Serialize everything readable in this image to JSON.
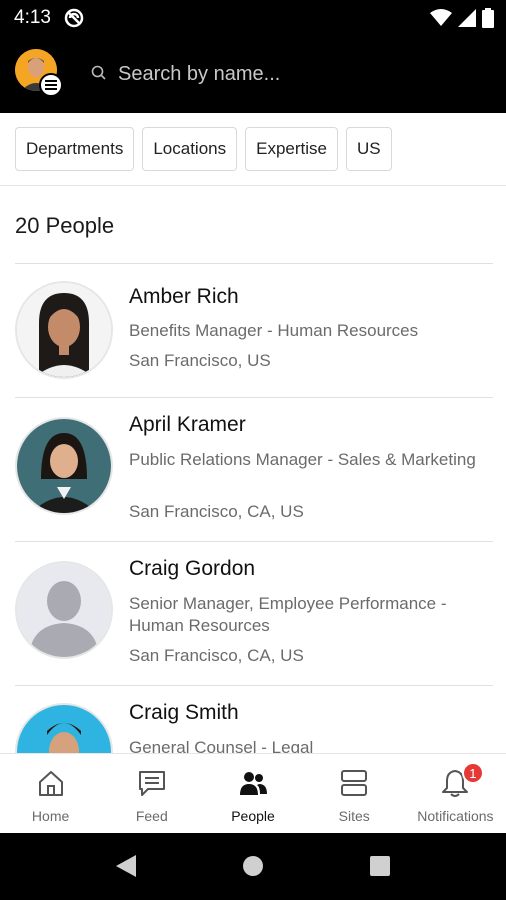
{
  "status_bar": {
    "time": "4:13"
  },
  "header": {
    "search_placeholder": "Search by name..."
  },
  "filters": [
    {
      "label": "Departments"
    },
    {
      "label": "Locations"
    },
    {
      "label": "Expertise"
    },
    {
      "label": "US"
    }
  ],
  "people_count": "20 People",
  "people": [
    {
      "name": "Amber Rich",
      "title": "Benefits Manager - Human Resources",
      "location": "San Francisco, US"
    },
    {
      "name": "April Kramer",
      "title": "Public Relations Manager - Sales & Marketing",
      "location": "San Francisco, CA, US"
    },
    {
      "name": "Craig Gordon",
      "title": "Senior Manager, Employee Performance - Human Resources",
      "location": "San Francisco, CA, US"
    },
    {
      "name": "Craig Smith",
      "title": "General Counsel - Legal",
      "location": ""
    }
  ],
  "tabs": [
    {
      "label": "Home"
    },
    {
      "label": "Feed"
    },
    {
      "label": "People"
    },
    {
      "label": "Sites"
    },
    {
      "label": "Notifications"
    }
  ],
  "notifications_badge": "1",
  "colors": {
    "accent": "#e53935",
    "header_bg": "#000000"
  }
}
